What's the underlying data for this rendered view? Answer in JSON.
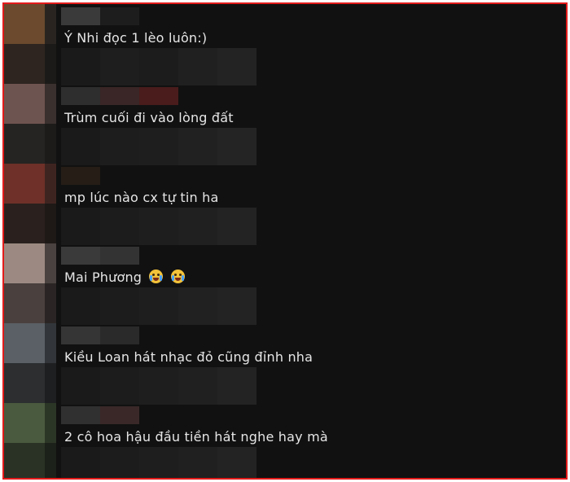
{
  "comments": [
    {
      "text": "Ý Nhi đọc 1 lèo luôn:)"
    },
    {
      "text": "Trùm cuối đi vào lòng đất"
    },
    {
      "text": "mp lúc nào cx tự tin ha"
    },
    {
      "text": "Mai Phương",
      "emojis": [
        "loudly-crying-face-icon",
        "loudly-crying-face-icon"
      ]
    },
    {
      "text": "Kiều Loan hát nhạc đỏ cũng đỉnh nha"
    },
    {
      "text": "2 cô hoa hậu đầu tiền hát nghe hay mà"
    }
  ],
  "colors": {
    "frame_border": "#e31b1b",
    "background": "#111111",
    "text": "#e6e6e6"
  }
}
